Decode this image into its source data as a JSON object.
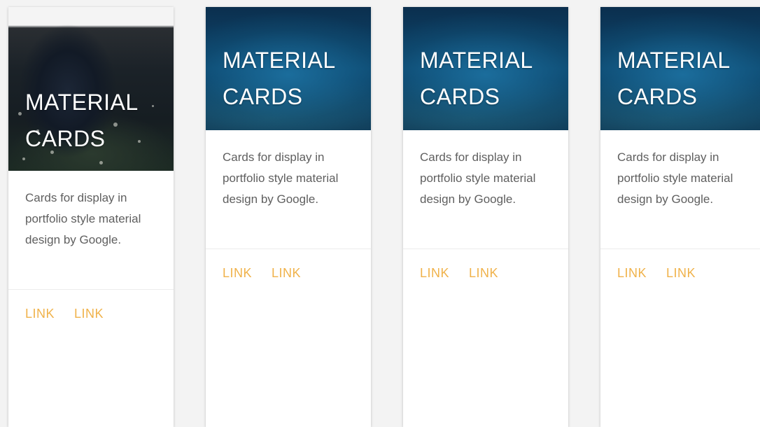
{
  "cards": [
    {
      "image": "hooded-person-in-flower-field",
      "title_line1": "MATERIAL",
      "title_line2": "CARDS",
      "description": "Cards for display in portfolio style material design by Google.",
      "links": [
        "LINK",
        "LINK"
      ]
    },
    {
      "image": "deep-blue-ocean-surface",
      "title_line1": "MATERIAL",
      "title_line2": "CARDS",
      "description": "Cards for display in portfolio style material design by Google.",
      "links": [
        "LINK",
        "LINK"
      ]
    },
    {
      "image": "deep-blue-ocean-surface",
      "title_line1": "MATERIAL",
      "title_line2": "CARDS",
      "description": "Cards for display in portfolio style material design by Google.",
      "links": [
        "LINK",
        "LINK"
      ]
    },
    {
      "image": "deep-blue-ocean-surface",
      "title_line1": "MATERIAL",
      "title_line2": "CARDS",
      "description": "Cards for display in portfolio style material design by Google.",
      "links": [
        "LINK",
        "LINK"
      ]
    }
  ],
  "colors": {
    "link": "#f0b24a",
    "text": "#5f5f5f",
    "card_bg": "#ffffff",
    "page_bg": "#f3f3f3"
  }
}
